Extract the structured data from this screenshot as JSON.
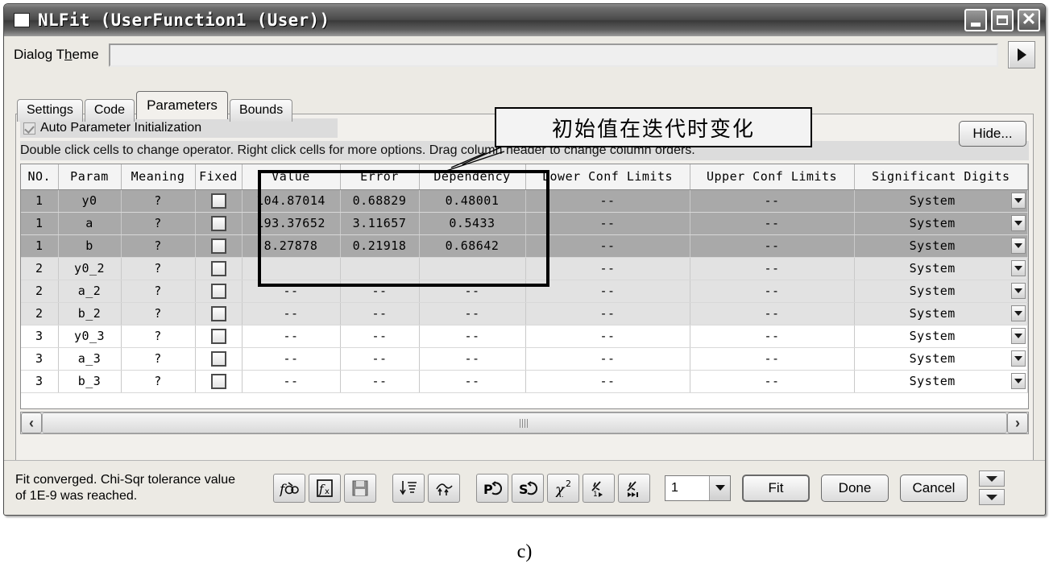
{
  "window": {
    "title": "NLFit (UserFunction1 (User))",
    "icon": "window-icon",
    "minimize_label": "minimize",
    "maximize_label": "maximize",
    "close_label": "close"
  },
  "theme": {
    "label_pre": "Dialog T",
    "label_underline": "h",
    "label_post": "eme",
    "value": "",
    "placeholder": "",
    "expand_label": "expand"
  },
  "tabs": [
    {
      "label": "Settings",
      "active": false
    },
    {
      "label": "Code",
      "active": false
    },
    {
      "label": "Parameters",
      "active": true
    },
    {
      "label": "Bounds",
      "active": false
    }
  ],
  "panel": {
    "auto_init_label": "Auto Parameter Initialization",
    "auto_init_checked": true,
    "hint": "Double click cells to change operator. Right click cells for more options. Drag column header to change column orders.",
    "hide_button": "Hide..."
  },
  "grid": {
    "columns": [
      "NO.",
      "Param",
      "Meaning",
      "Fixed",
      "Value",
      "Error",
      "Dependency",
      "Lower Conf Limits",
      "Upper Conf Limits",
      "Significant Digits"
    ],
    "rows": [
      {
        "no": "1",
        "param": "y0",
        "meaning": "?",
        "fixed": false,
        "value": "104.87014",
        "error": "0.68829",
        "dependency": "0.48001",
        "lower": "--",
        "upper": "--",
        "significant": "System",
        "band": "a"
      },
      {
        "no": "1",
        "param": "a",
        "meaning": "?",
        "fixed": false,
        "value": "193.37652",
        "error": "3.11657",
        "dependency": "0.5433",
        "lower": "--",
        "upper": "--",
        "significant": "System",
        "band": "a"
      },
      {
        "no": "1",
        "param": "b",
        "meaning": "?",
        "fixed": false,
        "value": "8.27878",
        "error": "0.21918",
        "dependency": "0.68642",
        "lower": "--",
        "upper": "--",
        "significant": "System",
        "band": "a"
      },
      {
        "no": "2",
        "param": "y0_2",
        "meaning": "?",
        "fixed": false,
        "value": "",
        "error": "",
        "dependency": "",
        "lower": "--",
        "upper": "--",
        "significant": "System",
        "band": "b"
      },
      {
        "no": "2",
        "param": "a_2",
        "meaning": "?",
        "fixed": false,
        "value": "--",
        "error": "--",
        "dependency": "--",
        "lower": "--",
        "upper": "--",
        "significant": "System",
        "band": "b"
      },
      {
        "no": "2",
        "param": "b_2",
        "meaning": "?",
        "fixed": false,
        "value": "--",
        "error": "--",
        "dependency": "--",
        "lower": "--",
        "upper": "--",
        "significant": "System",
        "band": "b"
      },
      {
        "no": "3",
        "param": "y0_3",
        "meaning": "?",
        "fixed": false,
        "value": "--",
        "error": "--",
        "dependency": "--",
        "lower": "--",
        "upper": "--",
        "significant": "System",
        "band": "c"
      },
      {
        "no": "3",
        "param": "a_3",
        "meaning": "?",
        "fixed": false,
        "value": "--",
        "error": "--",
        "dependency": "--",
        "lower": "--",
        "upper": "--",
        "significant": "System",
        "band": "c"
      },
      {
        "no": "3",
        "param": "b_3",
        "meaning": "?",
        "fixed": false,
        "value": "--",
        "error": "--",
        "dependency": "--",
        "lower": "--",
        "upper": "--",
        "significant": "System",
        "band": "c"
      }
    ]
  },
  "scrollbar": {
    "left_arrow": "‹",
    "right_arrow": "›"
  },
  "status": {
    "line1": "Fit converged. Chi-Sqr tolerance value",
    "line2": "of 1E-9 was reached."
  },
  "toolbar": {
    "buttons": [
      {
        "name": "fit-function-icon",
        "glyph": "ƒᵒᵒ"
      },
      {
        "name": "formula-file-icon",
        "glyph": "fₓ"
      },
      {
        "name": "save-icon",
        "glyph": "💾"
      },
      {
        "name": "initialize-down-icon",
        "glyph": "↓≣"
      },
      {
        "name": "peak-up-icon",
        "glyph": "⇈"
      },
      {
        "name": "reset-parameters-icon",
        "glyph": "P↶"
      },
      {
        "name": "reset-settings-icon",
        "glyph": "S↶"
      },
      {
        "name": "chi-square-icon",
        "glyph": "χ²"
      },
      {
        "name": "one-iteration-icon",
        "glyph": "⤳ᵢ"
      },
      {
        "name": "all-iterations-icon",
        "glyph": "⤳‣"
      }
    ],
    "iteration_count": "1",
    "fit_label": "Fit",
    "done_label": "Done",
    "cancel_label": "Cancel",
    "spin_down_1": "spin-down",
    "spin_down_2": "spin-down"
  },
  "annotation": {
    "callout_text": "初始值在迭代时变化",
    "highlight_columns": [
      "Value",
      "Error",
      "Dependency"
    ]
  },
  "caption": "c)",
  "colors": {
    "window_bg": "#eceae4",
    "panel_bg": "#f2f0ec",
    "band_a": "#a9a9a9",
    "band_b": "#e2e2e2",
    "band_c": "#ffffff",
    "accent": "#000000"
  }
}
